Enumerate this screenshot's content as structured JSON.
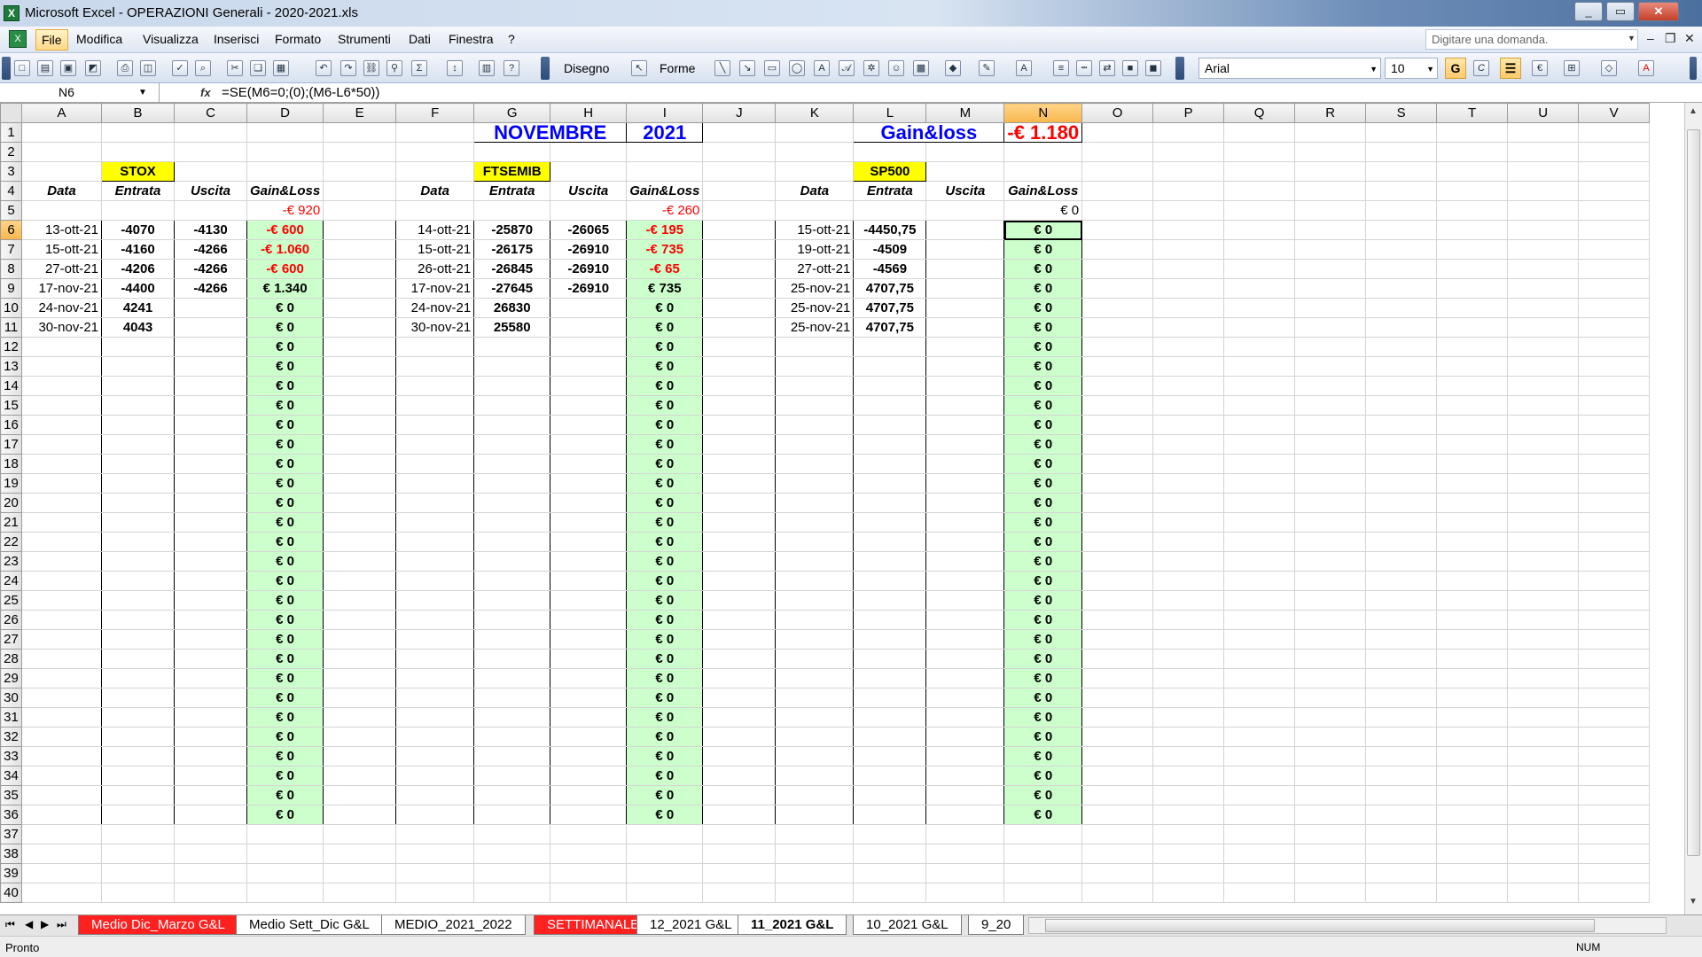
{
  "window": {
    "title": "Microsoft Excel - OPERAZIONI Generali - 2020-2021.xls",
    "minimize": "_",
    "maximize": "▭",
    "close": "✕"
  },
  "menu": {
    "items": [
      "File",
      "Modifica",
      "Visualizza",
      "Inserisci",
      "Formato",
      "Strumenti",
      "Dati",
      "Finestra",
      "?"
    ],
    "ask_placeholder": "Digitare una domanda."
  },
  "toolbar": {
    "drawing_label": "Disegno",
    "shapes_label": "Forme",
    "font": "Arial",
    "font_size": "10",
    "bold": "G",
    "italic": "C",
    "euro": "€"
  },
  "formula_bar": {
    "cell_ref": "N6",
    "fx": "fx",
    "formula": "=SE(M6=0;(0);(M6-L6*50))"
  },
  "columns": [
    "A",
    "B",
    "C",
    "D",
    "E",
    "F",
    "G",
    "H",
    "I",
    "J",
    "K",
    "L",
    "M",
    "N",
    "O",
    "P",
    "Q",
    "R",
    "S",
    "T",
    "U",
    "V"
  ],
  "sheet": {
    "month": "NOVEMBRE",
    "year": "2021",
    "gain_loss_label": "Gain&loss",
    "gain_loss_total": "-€ 1.180",
    "headers": {
      "date": "Data",
      "entry": "Entrata",
      "exit": "Uscita",
      "gl": "Gain&Loss"
    },
    "zero_value": "€ 0",
    "stox": {
      "label": "STOX",
      "total": "-€ 920",
      "rows": [
        {
          "date": "13-ott-21",
          "entry": "-4070",
          "exit": "-4130",
          "gl": "-€ 600"
        },
        {
          "date": "15-ott-21",
          "entry": "-4160",
          "exit": "-4266",
          "gl": "-€ 1.060"
        },
        {
          "date": "27-ott-21",
          "entry": "-4206",
          "exit": "-4266",
          "gl": "-€ 600"
        },
        {
          "date": "17-nov-21",
          "entry": "-4400",
          "exit": "-4266",
          "gl": "€ 1.340"
        },
        {
          "date": "24-nov-21",
          "entry": "4241",
          "exit": "",
          "gl": "€ 0"
        },
        {
          "date": "30-nov-21",
          "entry": "4043",
          "exit": "",
          "gl": "€ 0"
        }
      ]
    },
    "ftsemib": {
      "label": "FTSEMIB",
      "total": "-€ 260",
      "rows": [
        {
          "date": "14-ott-21",
          "entry": "-25870",
          "exit": "-26065",
          "gl": "-€ 195"
        },
        {
          "date": "15-ott-21",
          "entry": "-26175",
          "exit": "-26910",
          "gl": "-€ 735"
        },
        {
          "date": "26-ott-21",
          "entry": "-26845",
          "exit": "-26910",
          "gl": "-€ 65"
        },
        {
          "date": "17-nov-21",
          "entry": "-27645",
          "exit": "-26910",
          "gl": "€ 735"
        },
        {
          "date": "24-nov-21",
          "entry": "26830",
          "exit": "",
          "gl": "€ 0"
        },
        {
          "date": "30-nov-21",
          "entry": "25580",
          "exit": "",
          "gl": "€ 0"
        }
      ]
    },
    "sp500": {
      "label": "SP500",
      "total": "€ 0",
      "rows": [
        {
          "date": "15-ott-21",
          "entry": "-4450,75",
          "exit": "",
          "gl": "€ 0"
        },
        {
          "date": "19-ott-21",
          "entry": "-4509",
          "exit": "",
          "gl": "€ 0"
        },
        {
          "date": "27-ott-21",
          "entry": "-4569",
          "exit": "",
          "gl": "€ 0"
        },
        {
          "date": "25-nov-21",
          "entry": "4707,75",
          "exit": "",
          "gl": "€ 0"
        },
        {
          "date": "25-nov-21",
          "entry": "4707,75",
          "exit": "",
          "gl": "€ 0"
        },
        {
          "date": "25-nov-21",
          "entry": "4707,75",
          "exit": "",
          "gl": "€ 0"
        }
      ]
    }
  },
  "tabs": [
    {
      "label": "Medio Dic_Marzo G&L",
      "style": "red"
    },
    {
      "label": "Medio Sett_Dic G&L",
      "style": "normal"
    },
    {
      "label": "MEDIO_2021_2022",
      "style": "normal"
    },
    {
      "label": "SETTIMANALE",
      "style": "red"
    },
    {
      "label": "12_2021 G&L",
      "style": "normal"
    },
    {
      "label": "11_2021 G&L",
      "style": "active"
    },
    {
      "label": "10_2021 G&L",
      "style": "normal"
    },
    {
      "label": "9_20",
      "style": "normal"
    }
  ],
  "status": {
    "text": "Pronto",
    "num": "NUM"
  },
  "colors": {
    "gl_fill": "#ccffcc",
    "label_fill": "#ffff00",
    "negative": "#ff0000",
    "title_blue": "#0000ff"
  }
}
